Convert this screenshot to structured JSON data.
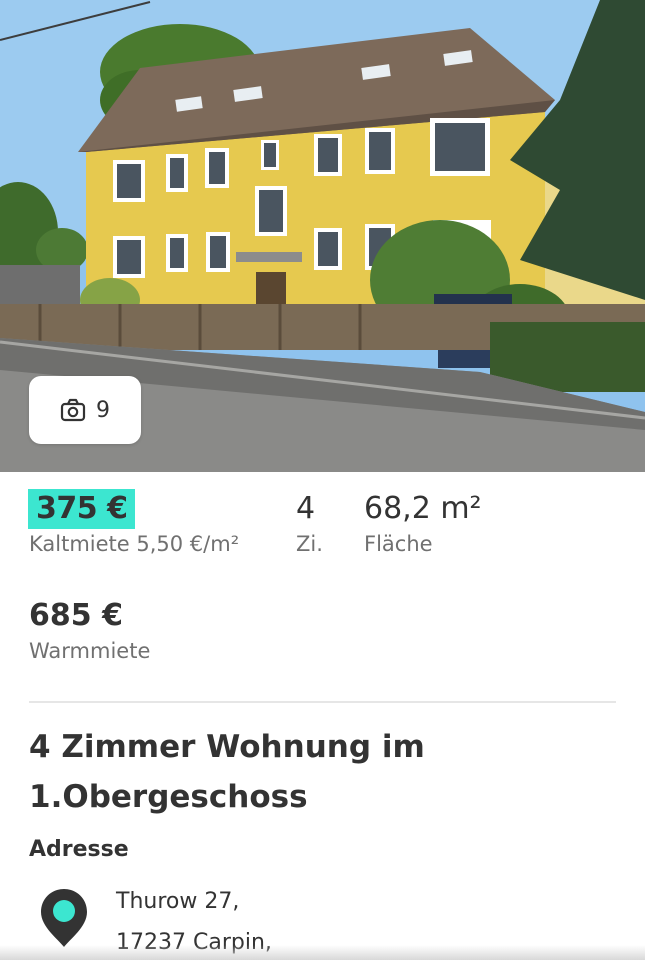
{
  "gallery": {
    "photo_count": "9",
    "camera_icon": "camera-icon"
  },
  "listing": {
    "price_cold": "375 €",
    "price_cold_label": "Kaltmiete 5,50 €/m²",
    "rooms": "4",
    "rooms_unit": "Zi.",
    "area": "68,2 m²",
    "area_label": "Fläche",
    "price_warm": "685 €",
    "price_warm_label": "Warmmiete",
    "title": "4 Zimmer Wohnung im 1.Obergeschoss"
  },
  "address": {
    "label": "Adresse",
    "street": "Thurow 27,",
    "city": "17237 Carpin,",
    "pin_icon": "location-pin-icon"
  },
  "colors": {
    "accent": "#3ce6d0",
    "text_primary": "#333333",
    "text_secondary": "#707070",
    "divider": "#e6e6e6"
  }
}
